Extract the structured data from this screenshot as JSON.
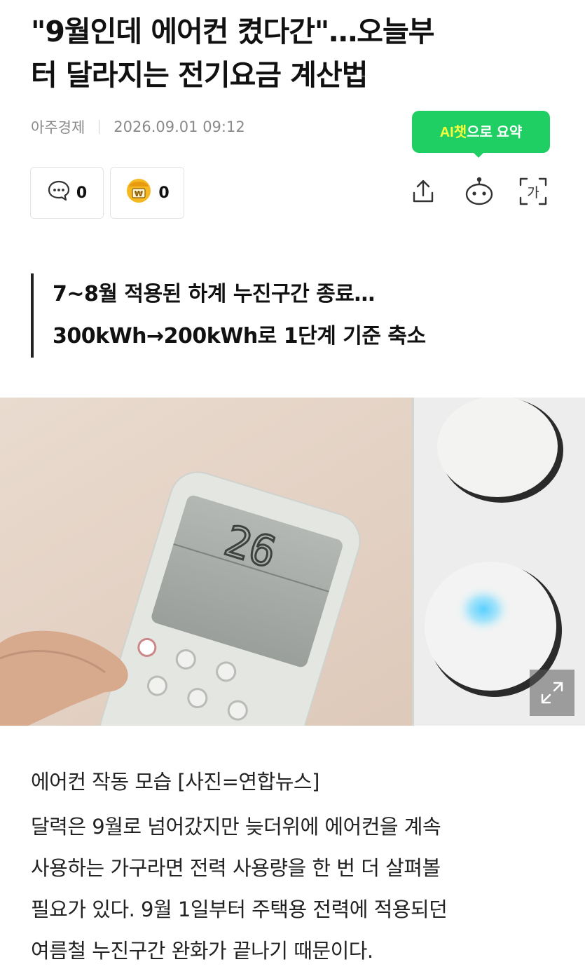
{
  "article": {
    "title_line1": "\"9월인데 에어컨 켰다간\"…오늘부",
    "title_line2": "터 달라지는 전기요금 계산법",
    "source": "아주경제",
    "datetime": "2026.09.01 09:12"
  },
  "ai_summary": {
    "highlight": "AI챗",
    "label": "으로 요약"
  },
  "reactions": {
    "comments_count": "0",
    "emoji_count": "0"
  },
  "toolbar": {
    "icons": [
      "share-icon",
      "ai-bot-icon",
      "font-size-icon"
    ],
    "font_size_glyph": "가"
  },
  "subheadline": {
    "line1": "7~8월 적용된 하계 누진구간 종료…",
    "line2": "300kWh→200kWh로 1단계 기준 축소"
  },
  "photo": {
    "display_reading": "26",
    "caption": "에어컨 작동 모습 [사진=연합뉴스]"
  },
  "body": {
    "lines": [
      "달력은 9월로 넘어갔지만 늦더위에 에어컨을 계속",
      "사용하는 가구라면 전력 사용량을 한 번 더 살펴볼",
      "필요가 있다. 9월 1일부터 주택용 전력에 적용되던",
      "여름철 누진구간 완화가 끝나기 때문이다."
    ]
  },
  "colors": {
    "ai_button": "#1fcf63",
    "ai_highlight": "#f7ff3c",
    "meta_text": "#8a8a8a",
    "emoji_yellow": "#f5b820"
  }
}
